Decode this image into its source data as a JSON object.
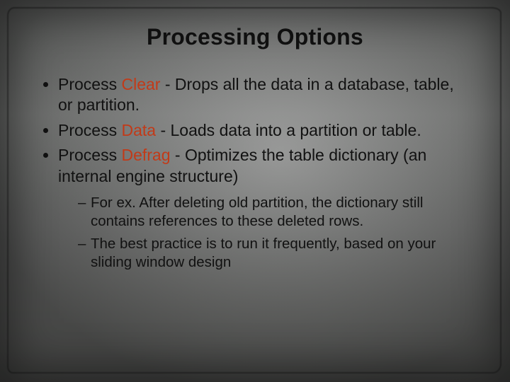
{
  "title": "Processing Options",
  "bullets": [
    {
      "prefix": "Process ",
      "keyword": "Clear",
      "rest": " - Drops all the data in a database, table, or partition."
    },
    {
      "prefix": "Process ",
      "keyword": "Data",
      "rest": " - Loads data into a partition or table."
    },
    {
      "prefix": "Process ",
      "keyword": "Defrag",
      "rest": " - Optimizes the table dictionary (an internal engine structure)"
    }
  ],
  "subbullets": [
    "For ex. After deleting old partition, the dictionary still contains references to these deleted rows.",
    "The best practice is to run it frequently, based on your sliding window design"
  ]
}
